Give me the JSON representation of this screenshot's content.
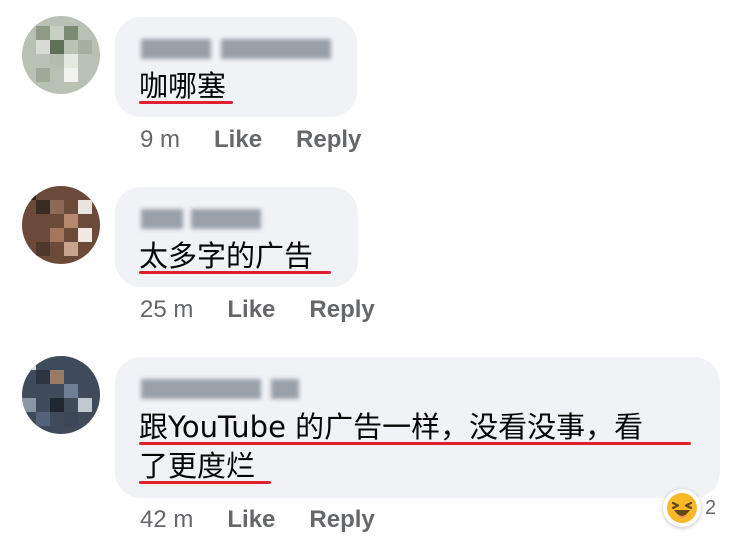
{
  "comments": [
    {
      "text_lines": [
        "咖哪塞"
      ],
      "time": "9 m",
      "like_label": "Like",
      "reply_label": "Reply"
    },
    {
      "text_lines": [
        "太多字的广告"
      ],
      "time": "25 m",
      "like_label": "Like",
      "reply_label": "Reply"
    },
    {
      "text_lines": [
        "跟YouTube 的广告一样，没看没事，看",
        "了更度烂"
      ],
      "time": "42 m",
      "like_label": "Like",
      "reply_label": "Reply",
      "reaction": {
        "icon": "laughing-emoji-icon",
        "count": "2"
      }
    }
  ],
  "colors": {
    "bubble": "#f0f2f5",
    "meta_text": "#65676b",
    "underline": "#e0202f",
    "reaction_face": "#f7b928"
  }
}
